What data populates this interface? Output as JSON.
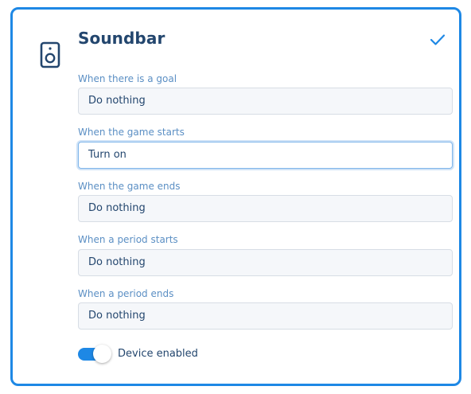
{
  "card": {
    "title": "Soundbar",
    "device_icon": "speaker-icon",
    "confirm_icon": "check-icon"
  },
  "fields": [
    {
      "label": "When there is a goal",
      "value": "Do nothing"
    },
    {
      "label": "When the game starts",
      "value": "Turn on"
    },
    {
      "label": "When the game ends",
      "value": "Do nothing"
    },
    {
      "label": "When a period starts",
      "value": "Do nothing"
    },
    {
      "label": "When a period ends",
      "value": "Do nothing"
    }
  ],
  "toggle": {
    "label": "Device enabled",
    "enabled": true
  },
  "colors": {
    "accent": "#1e88e5",
    "text": "#23466e",
    "label": "#5b8fc4"
  }
}
